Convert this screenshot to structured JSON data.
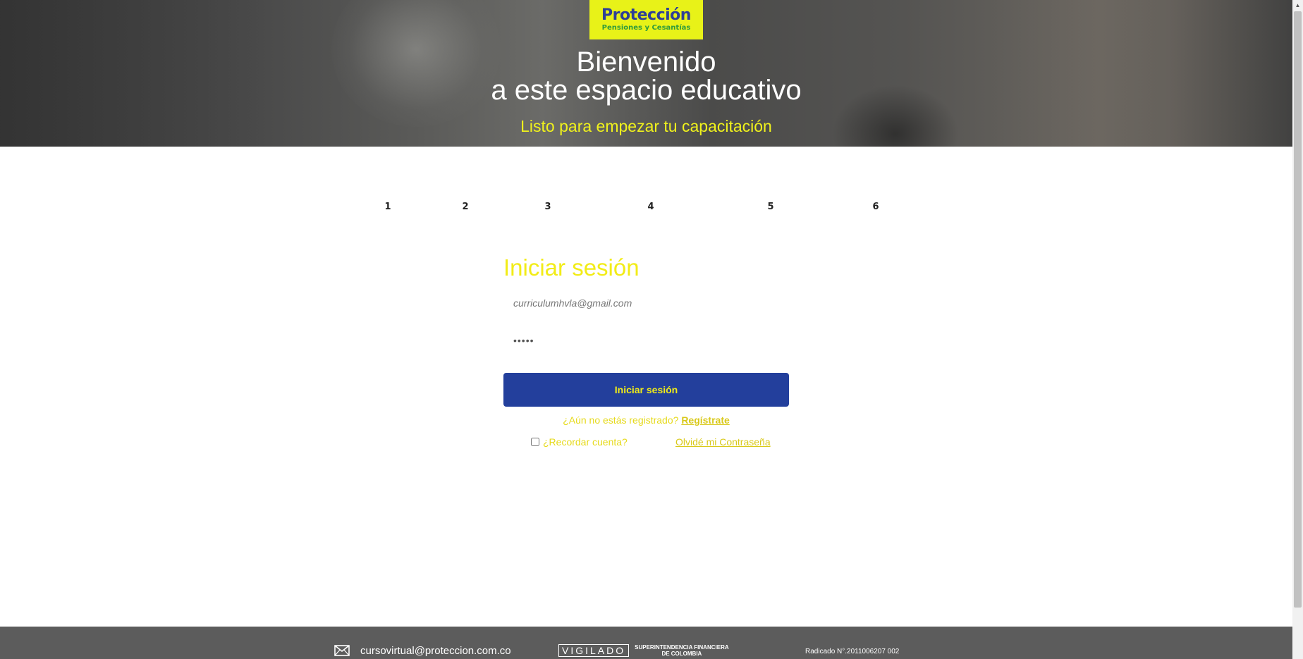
{
  "hero": {
    "logo_brand": "Protección",
    "logo_sub": "Pensiones y Cesantías",
    "title_line1": "Bienvenido",
    "title_line2": "a este espacio educativo",
    "subtitle": "Listo para empezar tu capacitación"
  },
  "steps": [
    "1",
    "2",
    "3",
    "4",
    "5",
    "6"
  ],
  "login": {
    "title": "Iniciar sesión",
    "email_value": "curriculumhvla@gmail.com",
    "password_value": "•••••",
    "submit_label": "Iniciar sesión",
    "register_prompt": "¿Aún no estás registrado?",
    "register_link": "Regístrate",
    "remember_label": "¿Recordar cuenta?",
    "forgot_link": "Olvidé mi Contraseña"
  },
  "footer": {
    "email": "cursovirtual@proteccion.com.co",
    "vigilado": "VIGILADO",
    "superintendencia_line1": "SUPERINTENDENCIA FINANCIERA",
    "superintendencia_line2": "DE COLOMBIA",
    "radicado": "Radicado N°.2011006207 002"
  },
  "colors": {
    "brand_yellow": "#e8f218",
    "brand_blue": "#233f9c",
    "text_yellow": "#f2ec17",
    "footer_gray": "#5c5c5c"
  },
  "icons": [
    "mail-icon",
    "scroll-up-arrow-icon"
  ]
}
